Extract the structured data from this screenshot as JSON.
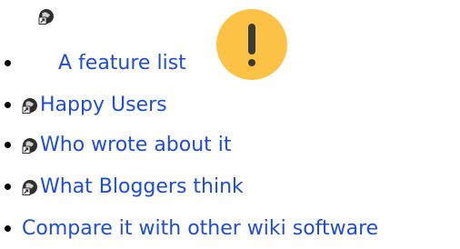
{
  "items": [
    {
      "label": "A feature list",
      "icon": "interwiki-link-icon"
    },
    {
      "label": "Happy Users",
      "icon": "interwiki-link-icon"
    },
    {
      "label": "Who wrote about it",
      "icon": "interwiki-link-icon"
    },
    {
      "label": "What Bloggers think",
      "icon": "interwiki-link-icon"
    },
    {
      "label": "Compare it with other wiki software"
    }
  ],
  "badge": {
    "icon": "exclamation-icon",
    "color": "#fcc245"
  },
  "colors": {
    "link": "#1e4fd2",
    "bullet": "#000000"
  }
}
